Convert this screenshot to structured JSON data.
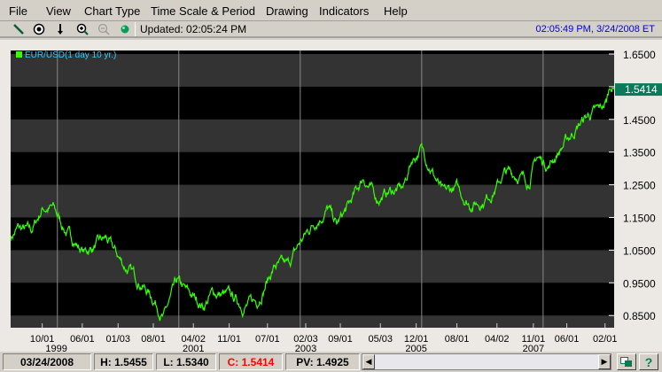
{
  "menu": [
    "File",
    "View",
    "Chart Type",
    "Time Scale & Period",
    "Drawing",
    "Indicators",
    "Help"
  ],
  "toolbar": {
    "icons": [
      "line-tool-icon",
      "crosshair-icon",
      "arrow-down-icon",
      "zoom-in-icon",
      "zoom-out-icon",
      "status-light-icon"
    ],
    "updated": "Updated: 02:05:24 PM",
    "clock": "02:05:49 PM, 3/24/2008 ET"
  },
  "chart_data": {
    "type": "line",
    "title": "EUR/USD(1 day  10 yr.)",
    "series_color": "#33ff00",
    "ylim": [
      0.82,
      1.66
    ],
    "yticks": [
      "1.6500",
      "1.5500",
      "1.4500",
      "1.3500",
      "1.2500",
      "1.1500",
      "1.0500",
      "0.9500",
      "0.8500"
    ],
    "ytick_values": [
      1.65,
      1.55,
      1.45,
      1.35,
      1.25,
      1.15,
      1.05,
      0.95,
      0.85
    ],
    "last_value": "1.5414",
    "xlim": [
      1998.23,
      2008.17
    ],
    "year_lines": [
      1999,
      2001,
      2003,
      2005,
      2007
    ],
    "xticks": [
      {
        "label": "10/01",
        "x": 1998.75,
        "year": "1999"
      },
      {
        "label": "06/01",
        "x": 1999.41
      },
      {
        "label": "01/03",
        "x": 2000.0
      },
      {
        "label": "08/01",
        "x": 2000.58
      },
      {
        "label": "04/02",
        "x": 2001.24,
        "year": "2001"
      },
      {
        "label": "11/01",
        "x": 2001.83
      },
      {
        "label": "07/01",
        "x": 2002.46
      },
      {
        "label": "02/03",
        "x": 2003.09,
        "year": "2003"
      },
      {
        "label": "09/01",
        "x": 2003.66
      },
      {
        "label": "05/03",
        "x": 2004.32
      },
      {
        "label": "12/01",
        "x": 2004.91,
        "year": "2005"
      },
      {
        "label": "08/01",
        "x": 2005.58
      },
      {
        "label": "04/02",
        "x": 2006.24
      },
      {
        "label": "11/01",
        "x": 2006.84,
        "year": "2007"
      },
      {
        "label": "06/01",
        "x": 2007.39
      },
      {
        "label": "02/01",
        "x": 2008.02
      }
    ],
    "points": [
      [
        1998.23,
        1.089
      ],
      [
        1998.35,
        1.116
      ],
      [
        1998.57,
        1.105
      ],
      [
        1998.76,
        1.18
      ],
      [
        1998.93,
        1.178
      ],
      [
        1999.15,
        1.105
      ],
      [
        1999.44,
        1.043
      ],
      [
        1999.8,
        1.083
      ],
      [
        2000.1,
        1.002
      ],
      [
        2000.39,
        0.948
      ],
      [
        2000.61,
        0.894
      ],
      [
        2000.75,
        0.845
      ],
      [
        2000.97,
        0.948
      ],
      [
        2001.12,
        0.921
      ],
      [
        2001.41,
        0.88
      ],
      [
        2001.56,
        0.92
      ],
      [
        2001.85,
        0.907
      ],
      [
        2002.07,
        0.88
      ],
      [
        2002.29,
        0.894
      ],
      [
        2002.43,
        0.948
      ],
      [
        2002.58,
        1.002
      ],
      [
        2002.8,
        1.0
      ],
      [
        2002.99,
        1.07
      ],
      [
        2003.24,
        1.138
      ],
      [
        2003.46,
        1.178
      ],
      [
        2003.6,
        1.124
      ],
      [
        2003.82,
        1.19
      ],
      [
        2004.04,
        1.273
      ],
      [
        2004.26,
        1.206
      ],
      [
        2004.48,
        1.23
      ],
      [
        2004.7,
        1.24
      ],
      [
        2004.84,
        1.327
      ],
      [
        2004.99,
        1.36
      ],
      [
        2005.13,
        1.314
      ],
      [
        2005.35,
        1.219
      ],
      [
        2005.57,
        1.24
      ],
      [
        2005.79,
        1.192
      ],
      [
        2006.0,
        1.2
      ],
      [
        2006.22,
        1.24
      ],
      [
        2006.37,
        1.287
      ],
      [
        2006.59,
        1.28
      ],
      [
        2006.76,
        1.26
      ],
      [
        2006.9,
        1.333
      ],
      [
        2007.09,
        1.31
      ],
      [
        2007.38,
        1.382
      ],
      [
        2007.6,
        1.436
      ],
      [
        2007.75,
        1.463
      ],
      [
        2007.94,
        1.477
      ],
      [
        2008.04,
        1.5
      ],
      [
        2008.11,
        1.558
      ],
      [
        2008.17,
        1.5414
      ]
    ]
  },
  "status": {
    "date": "03/24/2008",
    "high": "H: 1.5455",
    "low": "L: 1.5340",
    "close": "C: 1.5414",
    "pv": "PV: 1.4925",
    "close_color": "#ff0000"
  }
}
